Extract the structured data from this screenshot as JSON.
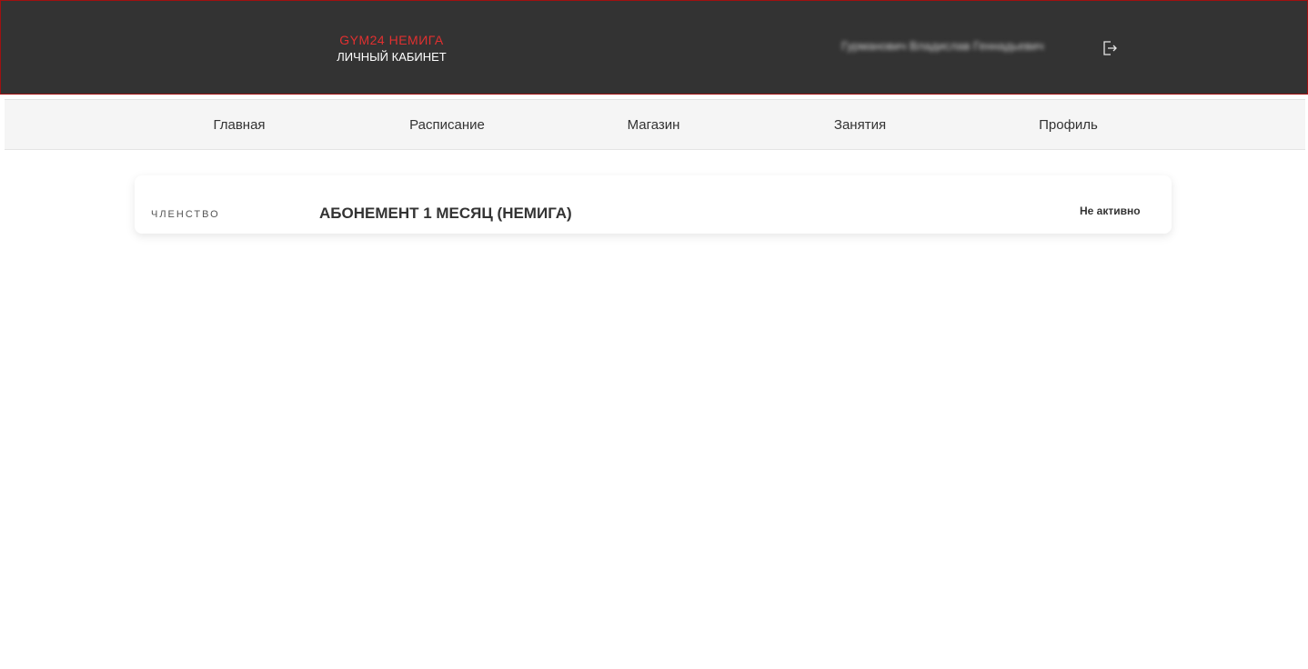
{
  "header": {
    "brand_name": "GYM24 НЕМИГА",
    "brand_subtitle": "ЛИЧНЫЙ КАБИНЕТ",
    "user_name": "Гурманович Владислав Геннадьевич",
    "logout_icon": "logout-icon"
  },
  "nav": {
    "items": [
      {
        "label": "Главная"
      },
      {
        "label": "Расписание"
      },
      {
        "label": "Магазин"
      },
      {
        "label": "Занятия"
      },
      {
        "label": "Профиль"
      }
    ]
  },
  "membership": {
    "kind_label": "ЧЛЕНСТВО",
    "title": "АБОНЕМЕНТ 1 МЕСЯЦ (НЕМИГА)",
    "status": "Не активно"
  },
  "colors": {
    "header_bg": "#333333",
    "brand_accent": "#e03030",
    "nav_bg": "#f5f5f5"
  }
}
